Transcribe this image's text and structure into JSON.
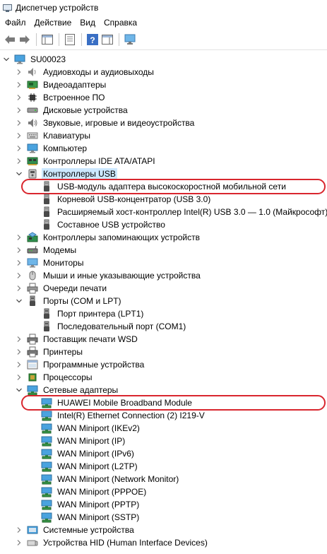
{
  "window": {
    "title": "Диспетчер устройств"
  },
  "menu": [
    "Файл",
    "Действие",
    "Вид",
    "Справка"
  ],
  "toolbar": {
    "buttons": [
      "back-icon",
      "forward-icon",
      "show-hide-console-tree-icon",
      "properties-icon",
      "help-icon",
      "action-pane-icon",
      "monitor-scan-icon"
    ]
  },
  "tree": {
    "root": "SU00023",
    "categories": [
      {
        "label": "Аудиовходы и аудиовыходы",
        "icon": "speaker-icon"
      },
      {
        "label": "Видеоадаптеры",
        "icon": "display-adapter-icon"
      },
      {
        "label": "Встроенное ПО",
        "icon": "chip-icon"
      },
      {
        "label": "Дисковые устройства",
        "icon": "disk-drive-icon"
      },
      {
        "label": "Звуковые, игровые и видеоустройства",
        "icon": "sound-icon"
      },
      {
        "label": "Клавиатуры",
        "icon": "keyboard-icon"
      },
      {
        "label": "Компьютер",
        "icon": "computer-icon"
      },
      {
        "label": "Контроллеры IDE ATA/ATAPI",
        "icon": "ide-controller-icon"
      },
      {
        "label": "Контроллеры USB",
        "icon": "usb-icon",
        "expanded": true,
        "selected": true,
        "children": [
          {
            "label": "USB-модуль адаптера высокоскоростной мобильной сети",
            "icon": "usb-plug-icon",
            "highlighted": true
          },
          {
            "label": "Корневой USB-концентратор (USB 3.0)",
            "icon": "usb-plug-icon"
          },
          {
            "label": "Расширяемый хост-контроллер Intel(R) USB 3.0 — 1.0 (Майкрософт)",
            "icon": "usb-plug-icon"
          },
          {
            "label": "Составное USB устройство",
            "icon": "usb-plug-icon"
          }
        ]
      },
      {
        "label": "Контроллеры запоминающих устройств",
        "icon": "storage-controller-icon"
      },
      {
        "label": "Модемы",
        "icon": "modem-icon"
      },
      {
        "label": "Мониторы",
        "icon": "monitor-icon"
      },
      {
        "label": "Мыши и иные указывающие устройства",
        "icon": "mouse-icon"
      },
      {
        "label": "Очереди печати",
        "icon": "print-queue-icon"
      },
      {
        "label": "Порты (COM и LPT)",
        "icon": "port-icon",
        "expanded": true,
        "children": [
          {
            "label": "Порт принтера (LPT1)",
            "icon": "port-icon"
          },
          {
            "label": "Последовательный порт (COM1)",
            "icon": "port-icon"
          }
        ]
      },
      {
        "label": "Поставщик печати WSD",
        "icon": "printer-icon"
      },
      {
        "label": "Принтеры",
        "icon": "printer-icon"
      },
      {
        "label": "Программные устройства",
        "icon": "software-device-icon"
      },
      {
        "label": "Процессоры",
        "icon": "processor-icon"
      },
      {
        "label": "Сетевые адаптеры",
        "icon": "network-adapter-icon",
        "expanded": true,
        "children": [
          {
            "label": "HUAWEI Mobile Broadband Module",
            "icon": "network-adapter-icon",
            "highlighted": true
          },
          {
            "label": "Intel(R) Ethernet Connection (2) I219-V",
            "icon": "network-adapter-icon"
          },
          {
            "label": "WAN Miniport (IKEv2)",
            "icon": "network-adapter-icon"
          },
          {
            "label": "WAN Miniport (IP)",
            "icon": "network-adapter-icon"
          },
          {
            "label": "WAN Miniport (IPv6)",
            "icon": "network-adapter-icon"
          },
          {
            "label": "WAN Miniport (L2TP)",
            "icon": "network-adapter-icon"
          },
          {
            "label": "WAN Miniport (Network Monitor)",
            "icon": "network-adapter-icon"
          },
          {
            "label": "WAN Miniport (PPPOE)",
            "icon": "network-adapter-icon"
          },
          {
            "label": "WAN Miniport (PPTP)",
            "icon": "network-adapter-icon"
          },
          {
            "label": "WAN Miniport (SSTP)",
            "icon": "network-adapter-icon"
          }
        ]
      },
      {
        "label": "Системные устройства",
        "icon": "system-device-icon"
      },
      {
        "label": "Устройства HID (Human Interface Devices)",
        "icon": "hid-icon"
      }
    ]
  },
  "colors": {
    "highlight": "#d9262e",
    "selection": "#cce8ff"
  }
}
